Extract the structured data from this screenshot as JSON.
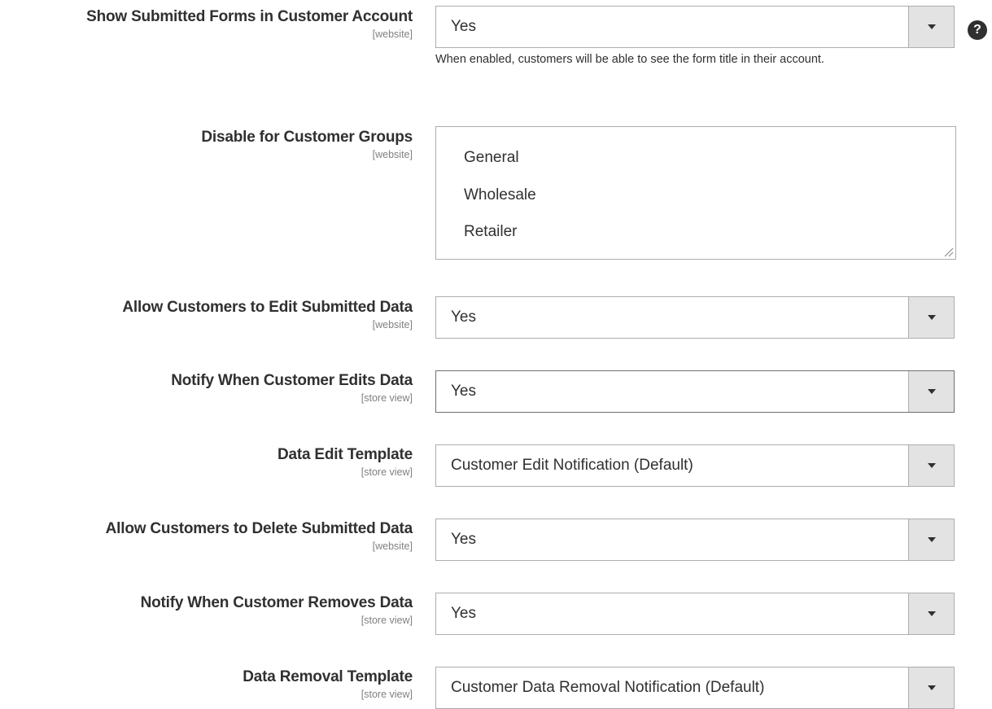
{
  "fields": [
    {
      "label": "Show Submitted Forms in Customer Account",
      "scope": "[website]",
      "value": "Yes",
      "note": "When enabled, customers will be able to see the form title in their account.",
      "help": "?"
    },
    {
      "label": "Disable for Customer Groups",
      "scope": "[website]",
      "options": [
        "General",
        "Wholesale",
        "Retailer"
      ]
    },
    {
      "label": "Allow Customers to Edit Submitted Data",
      "scope": "[website]",
      "value": "Yes"
    },
    {
      "label": "Notify When Customer Edits Data",
      "scope": "[store view]",
      "value": "Yes"
    },
    {
      "label": "Data Edit Template",
      "scope": "[store view]",
      "value": "Customer Edit Notification (Default)"
    },
    {
      "label": "Allow Customers to Delete Submitted Data",
      "scope": "[website]",
      "value": "Yes"
    },
    {
      "label": "Notify When Customer Removes Data",
      "scope": "[store view]",
      "value": "Yes"
    },
    {
      "label": "Data Removal Template",
      "scope": "[store view]",
      "value": "Customer Data Removal Notification (Default)"
    }
  ],
  "icons": {
    "help": "question-circle-icon",
    "dropdown": "chevron-down-icon",
    "resize": "resize-handle-icon"
  },
  "colors": {
    "text": "#303030",
    "scope": "#808080",
    "border": "#adadad",
    "arrow_bg": "#e3e3e3"
  }
}
